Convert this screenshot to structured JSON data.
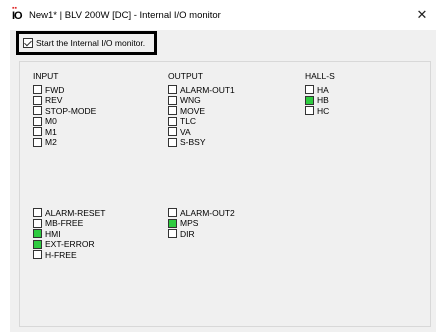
{
  "window": {
    "title": "New1* | BLV 200W [DC] - Internal I/O monitor",
    "close_label": "✕",
    "icon_name": "io-monitor-app-icon"
  },
  "start_monitor": {
    "label": "Start the Internal I/O monitor.",
    "checked": true
  },
  "groups": {
    "input": {
      "header": "INPUT",
      "items": [
        {
          "label": "FWD",
          "on": false
        },
        {
          "label": "REV",
          "on": false
        },
        {
          "label": "STOP-MODE",
          "on": false
        },
        {
          "label": "M0",
          "on": false
        },
        {
          "label": "M1",
          "on": false
        },
        {
          "label": "M2",
          "on": false
        }
      ],
      "items2": [
        {
          "label": "ALARM-RESET",
          "on": false
        },
        {
          "label": "MB-FREE",
          "on": false
        },
        {
          "label": "HMI",
          "on": true
        },
        {
          "label": "EXT-ERROR",
          "on": true
        },
        {
          "label": "H-FREE",
          "on": false
        }
      ]
    },
    "output": {
      "header": "OUTPUT",
      "items": [
        {
          "label": "ALARM-OUT1",
          "on": false
        },
        {
          "label": "WNG",
          "on": false
        },
        {
          "label": "MOVE",
          "on": false
        },
        {
          "label": "TLC",
          "on": false
        },
        {
          "label": "VA",
          "on": false
        },
        {
          "label": "S-BSY",
          "on": false
        }
      ],
      "items2": [
        {
          "label": "ALARM-OUT2",
          "on": false
        },
        {
          "label": "MPS",
          "on": true
        },
        {
          "label": "DIR",
          "on": false
        }
      ]
    },
    "hall": {
      "header": "HALL-S",
      "items": [
        {
          "label": "HA",
          "on": false
        },
        {
          "label": "HB",
          "on": true
        },
        {
          "label": "HC",
          "on": false
        }
      ]
    }
  },
  "colors": {
    "indicator_on": "#2ecc40",
    "indicator_off": "#ffffff",
    "background": "#f0f0f0"
  }
}
